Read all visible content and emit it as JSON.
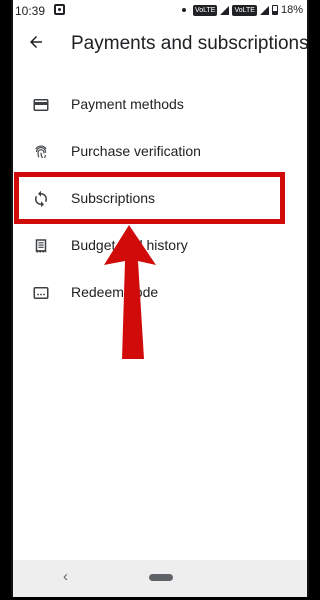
{
  "status_bar": {
    "time": "10:39",
    "battery": "18%",
    "network": "VoLTE"
  },
  "header": {
    "title": "Payments and subscriptions",
    "back_icon": "arrow-left-icon"
  },
  "menu": {
    "items": [
      {
        "label": "Payment methods",
        "icon": "credit-card-icon"
      },
      {
        "label": "Purchase verification",
        "icon": "fingerprint-icon"
      },
      {
        "label": "Subscriptions",
        "icon": "sync-icon"
      },
      {
        "label": "Budget and history",
        "icon": "receipt-icon"
      },
      {
        "label": "Redeem code",
        "icon": "redeem-card-icon"
      }
    ]
  },
  "annotation": {
    "highlight_color": "#d10a0a"
  },
  "nav_bar": {
    "back_icon": "chevron-left-icon",
    "home_icon": "home-pill-icon"
  }
}
